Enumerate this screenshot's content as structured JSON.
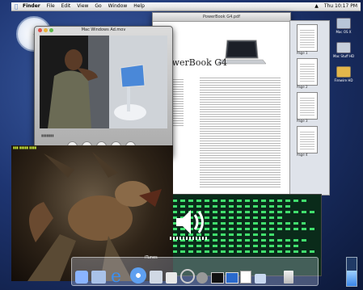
{
  "menubar": {
    "app": "Finder",
    "menus": [
      "File",
      "Edit",
      "View",
      "Go",
      "Window",
      "Help"
    ],
    "clock": "Thu 10:17 PM"
  },
  "doc_window": {
    "title": "PowerBook G4.pdf",
    "heading": "PowerBook G4"
  },
  "drawer": {
    "pages": [
      "Page 1",
      "Page 2",
      "Page 3",
      "Page 4"
    ]
  },
  "quicktime": {
    "title": "Mac Windows Ad.mov"
  },
  "desktop_icons": [
    {
      "label": "Mac OS X",
      "icon": "hard-drive-icon",
      "color": "#b8c6d8"
    },
    {
      "label": "Mac Stuff HD",
      "icon": "hard-drive-icon",
      "color": "#c7cfdb"
    },
    {
      "label": "Firewire HD",
      "icon": "firewire-drive-icon",
      "color": "#e3b64b"
    }
  ],
  "itunes": {
    "label": "iTunes"
  },
  "volume_level": 0.6,
  "cpu_level": 0.55,
  "colors": {
    "terminal_text": "#4bff7c",
    "hud_text": "#d9ff3b",
    "desktop": "#1e3572"
  },
  "dock_icons": [
    "finder-icon",
    "mail-icon",
    "internet-explorer-icon",
    "itunes-icon",
    "imovie-icon",
    "app-icon",
    "sherlock-icon",
    "system-preferences-icon",
    "terminal-icon",
    "monitor-icon",
    "pdf-icon",
    "folder-icon",
    "trash-icon"
  ]
}
